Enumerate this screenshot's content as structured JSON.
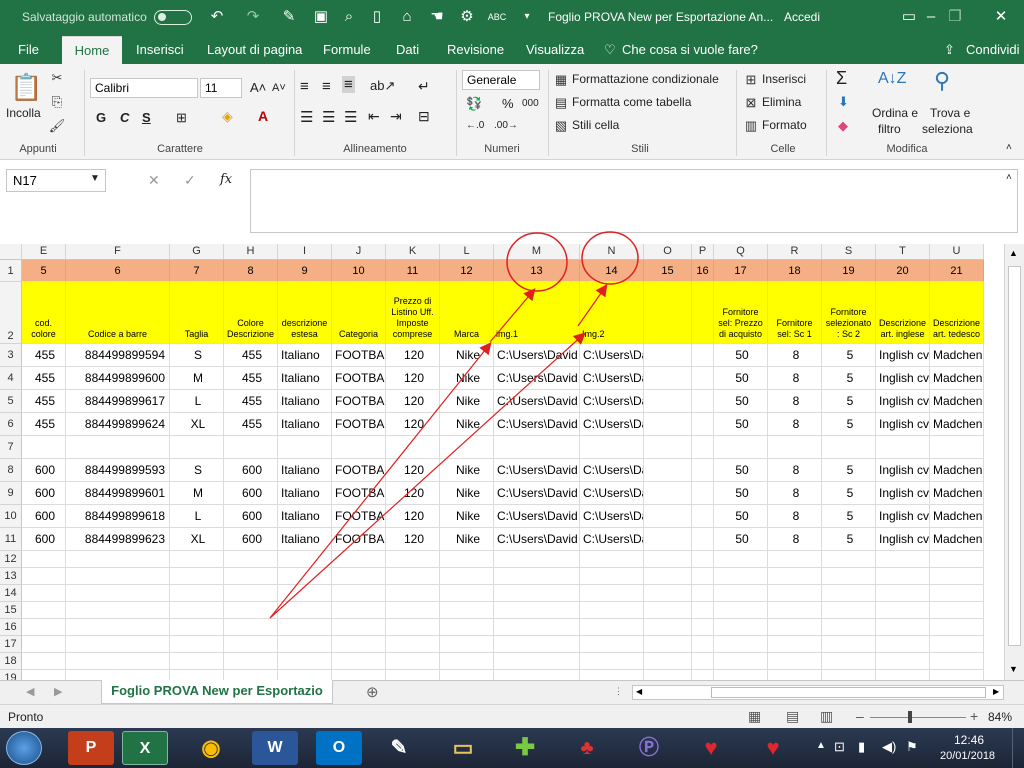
{
  "titlebar": {
    "autosave_label": "Salvataggio automatico",
    "doc_title": "Foglio PROVA New per Esportazione An...",
    "signin": "Accedi"
  },
  "menu": {
    "tabs": [
      "File",
      "Home",
      "Inserisci",
      "Layout di pagina",
      "Formule",
      "Dati",
      "Revisione",
      "Visualizza"
    ],
    "tell_me": "Che cosa si vuole fare?",
    "share": "Condividi"
  },
  "ribbon": {
    "clipboard": {
      "paste": "Incolla",
      "label": "Appunti"
    },
    "font": {
      "name": "Calibri",
      "size": "11",
      "bold": "G",
      "italic": "C",
      "underline": "S",
      "label": "Carattere"
    },
    "alignment": {
      "label": "Allineamento"
    },
    "number": {
      "format": "Generale",
      "percent": "%",
      "thousands": "000",
      "label": "Numeri"
    },
    "styles": {
      "conditional": "Formattazione condizionale",
      "table": "Formatta come tabella",
      "cell": "Stili cella",
      "label": "Stili"
    },
    "cells": {
      "insert": "Inserisci",
      "delete": "Elimina",
      "format": "Formato",
      "label": "Celle"
    },
    "editing": {
      "sort": "Ordina e",
      "sort2": "filtro",
      "find": "Trova e",
      "find2": "seleziona",
      "label": "Modifica"
    }
  },
  "formula": {
    "namebox": "N17",
    "fx": "fx",
    "value": ""
  },
  "columns": [
    "E",
    "F",
    "G",
    "H",
    "I",
    "J",
    "K",
    "L",
    "M",
    "N",
    "O",
    "P",
    "Q",
    "R",
    "S",
    "T",
    "U"
  ],
  "rows": {
    "row1": [
      "5",
      "6",
      "7",
      "8",
      "9",
      "10",
      "11",
      "12",
      "13",
      "14",
      "15",
      "16",
      "17",
      "18",
      "19",
      "20",
      "21"
    ],
    "row2": [
      "cod. colore",
      "Codice a barre",
      "Taglia",
      "Colore Descrizione",
      "descrizione estesa",
      "Categoria",
      "Prezzo di Listino Uff. Imposte comprese",
      "Marca",
      "img.1",
      "Img.2",
      "",
      "",
      "Fornitore sel: Prezzo di acquisto",
      "Fornitore sel: Sc 1",
      "Fornitore selezionato : Sc 2",
      "Descrizione art. inglese",
      "Descrizione art. tedesco"
    ],
    "data": [
      {
        "num": "3",
        "cells": [
          "455",
          "884499899594",
          "S",
          "455",
          "Italiano",
          "FOOTBALL",
          "120",
          "Nike",
          "C:\\Users\\David",
          "C:\\Users\\Davide\\Desktop",
          "",
          "",
          "50",
          "8",
          "5",
          "Inglish cv",
          "Madchen"
        ]
      },
      {
        "num": "4",
        "cells": [
          "455",
          "884499899600",
          "M",
          "455",
          "Italiano",
          "FOOTBALL",
          "120",
          "Nike",
          "C:\\Users\\David",
          "C:\\Users\\Davide\\Desktop",
          "",
          "",
          "50",
          "8",
          "5",
          "Inglish cv",
          "Madchen"
        ]
      },
      {
        "num": "5",
        "cells": [
          "455",
          "884499899617",
          "L",
          "455",
          "Italiano",
          "FOOTBALL",
          "120",
          "Nike",
          "C:\\Users\\David",
          "C:\\Users\\Davide\\Desktop",
          "",
          "",
          "50",
          "8",
          "5",
          "Inglish cv",
          "Madchen"
        ]
      },
      {
        "num": "6",
        "cells": [
          "455",
          "884499899624",
          "XL",
          "455",
          "Italiano",
          "FOOTBALL",
          "120",
          "Nike",
          "C:\\Users\\David",
          "C:\\Users\\Davide\\Desktop",
          "",
          "",
          "50",
          "8",
          "5",
          "Inglish cv",
          "Madchen"
        ]
      },
      {
        "num": "7",
        "cells": [
          "",
          "",
          "",
          "",
          "",
          "",
          "",
          "",
          "",
          "",
          "",
          "",
          "",
          "",
          "",
          "",
          ""
        ]
      },
      {
        "num": "8",
        "cells": [
          "600",
          "884499899593",
          "S",
          "600",
          "Italiano",
          "FOOTBALL",
          "120",
          "Nike",
          "C:\\Users\\David",
          "C:\\Users\\Davide\\Desktop",
          "",
          "",
          "50",
          "8",
          "5",
          "Inglish cv",
          "Madchen"
        ]
      },
      {
        "num": "9",
        "cells": [
          "600",
          "884499899601",
          "M",
          "600",
          "Italiano",
          "FOOTBALL",
          "120",
          "Nike",
          "C:\\Users\\David",
          "C:\\Users\\Davide\\Desktop",
          "",
          "",
          "50",
          "8",
          "5",
          "Inglish cv",
          "Madchen"
        ]
      },
      {
        "num": "10",
        "cells": [
          "600",
          "884499899618",
          "L",
          "600",
          "Italiano",
          "FOOTBALL",
          "120",
          "Nike",
          "C:\\Users\\David",
          "C:\\Users\\Davide\\Desktop",
          "",
          "",
          "50",
          "8",
          "5",
          "Inglish cv",
          "Madchen"
        ]
      },
      {
        "num": "11",
        "cells": [
          "600",
          "884499899623",
          "XL",
          "600",
          "Italiano",
          "FOOTBALL",
          "120",
          "Nike",
          "C:\\Users\\David",
          "C:\\Users\\Davide\\Desktop",
          "",
          "",
          "50",
          "8",
          "5",
          "Inglish cv",
          "Madchen"
        ]
      }
    ],
    "empty": [
      "12",
      "13",
      "14",
      "15",
      "16",
      "17",
      "18",
      "19"
    ]
  },
  "sheet": {
    "tab": "Foglio PROVA New per Esportazio"
  },
  "status": {
    "ready": "Pronto",
    "zoom": "84%"
  },
  "taskbar": {
    "time": "12:46",
    "date": "20/01/2018"
  },
  "colors": {
    "accent": "#217346",
    "row1": "#f4b084",
    "row2": "#ffff00",
    "annotation": "#e02020"
  }
}
